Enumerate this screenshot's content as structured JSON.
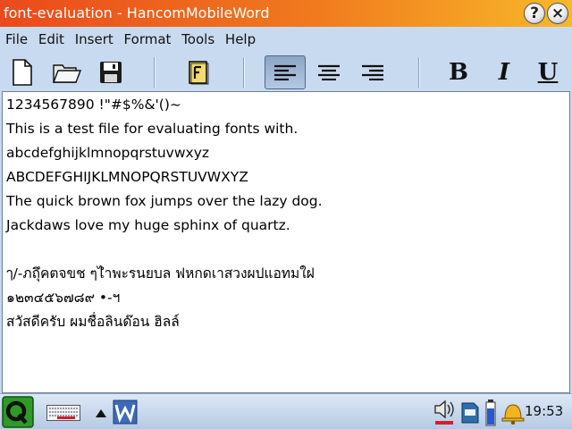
{
  "window": {
    "title": "font-evaluation - HancomMobileWord"
  },
  "menu": [
    "File",
    "Edit",
    "Insert",
    "Format",
    "Tools",
    "Help"
  ],
  "document": {
    "lines": [
      "1234567890 !\"#$%&'()~",
      "This is a test file for evaluating fonts with.",
      "abcdefghijklmnopqrstuvwxyz",
      "ABCDEFGHIJKLMNOPQRSTUVWXYZ",
      "The quick brown fox jumps over the lazy dog.",
      "Jackdaws love my huge sphinx of quartz.",
      "",
      "ๅ/-ภถุึคตจขช ๆไำพะรนยบล ฟหกดเาสวงผปแอทมใฝ",
      "๑๒๓๔๕๖๗๘๙ •-ฯ",
      "สวัสดีครับ ผมชื่อลินด๊อน ฮิลล์"
    ]
  },
  "toolbar": {
    "format_bold": "B",
    "format_italic": "I",
    "format_underline": "U",
    "active_tool": "align-left"
  },
  "taskbar": {
    "clock": "19:53"
  },
  "colors": {
    "title_start": "#ea4a1c",
    "title_end": "#f7b82a",
    "chrome": "#c8daf0",
    "active_tool": "#8ca4c4"
  }
}
